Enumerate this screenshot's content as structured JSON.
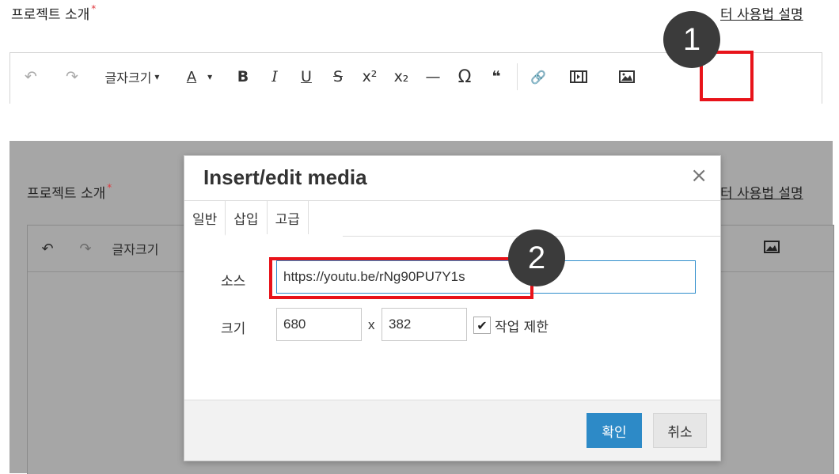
{
  "section": {
    "title": "프로젝트 소개",
    "required_mark": "*",
    "help_link": "에디터 사용법 설명",
    "help_link_top_visible": "터 사용법 설명",
    "help_link_dimmed_visible": "터 사용법 설명"
  },
  "toolbar": {
    "undo_icon": "↶",
    "redo_icon": "↷",
    "font_size_label": "글자크기",
    "font_size_caret": "▾",
    "font_color_icon": "A",
    "font_color_caret": "▾",
    "bold_icon": "B",
    "italic_icon": "I",
    "underline_icon": "U",
    "strike_icon": "S",
    "superscript_icon": "x²",
    "subscript_icon": "x₂",
    "hr_icon": "—",
    "special_char_icon": "Ω",
    "quote_icon": "❝",
    "link_icon": "🔗",
    "media_icon": "media-icon",
    "image_icon": "image-icon"
  },
  "markers": {
    "step1": "1",
    "step2": "2",
    "highlight_color": "#e8131a"
  },
  "dialog": {
    "title": "Insert/edit media",
    "close_icon": "×",
    "tabs": [
      {
        "label": "일반"
      },
      {
        "label": "삽입"
      },
      {
        "label": "고급"
      }
    ],
    "source_label": "소스",
    "source_value": "https://youtu.be/rNg90PU7Y1s",
    "size_label": "크기",
    "width_value": "680",
    "x_label": "x",
    "height_value": "382",
    "constrain_checked": true,
    "constrain_checkmark": "✔",
    "constrain_label": "작업 제한",
    "ok_label": "확인",
    "cancel_label": "취소",
    "accent_color": "#2d8ac7"
  }
}
